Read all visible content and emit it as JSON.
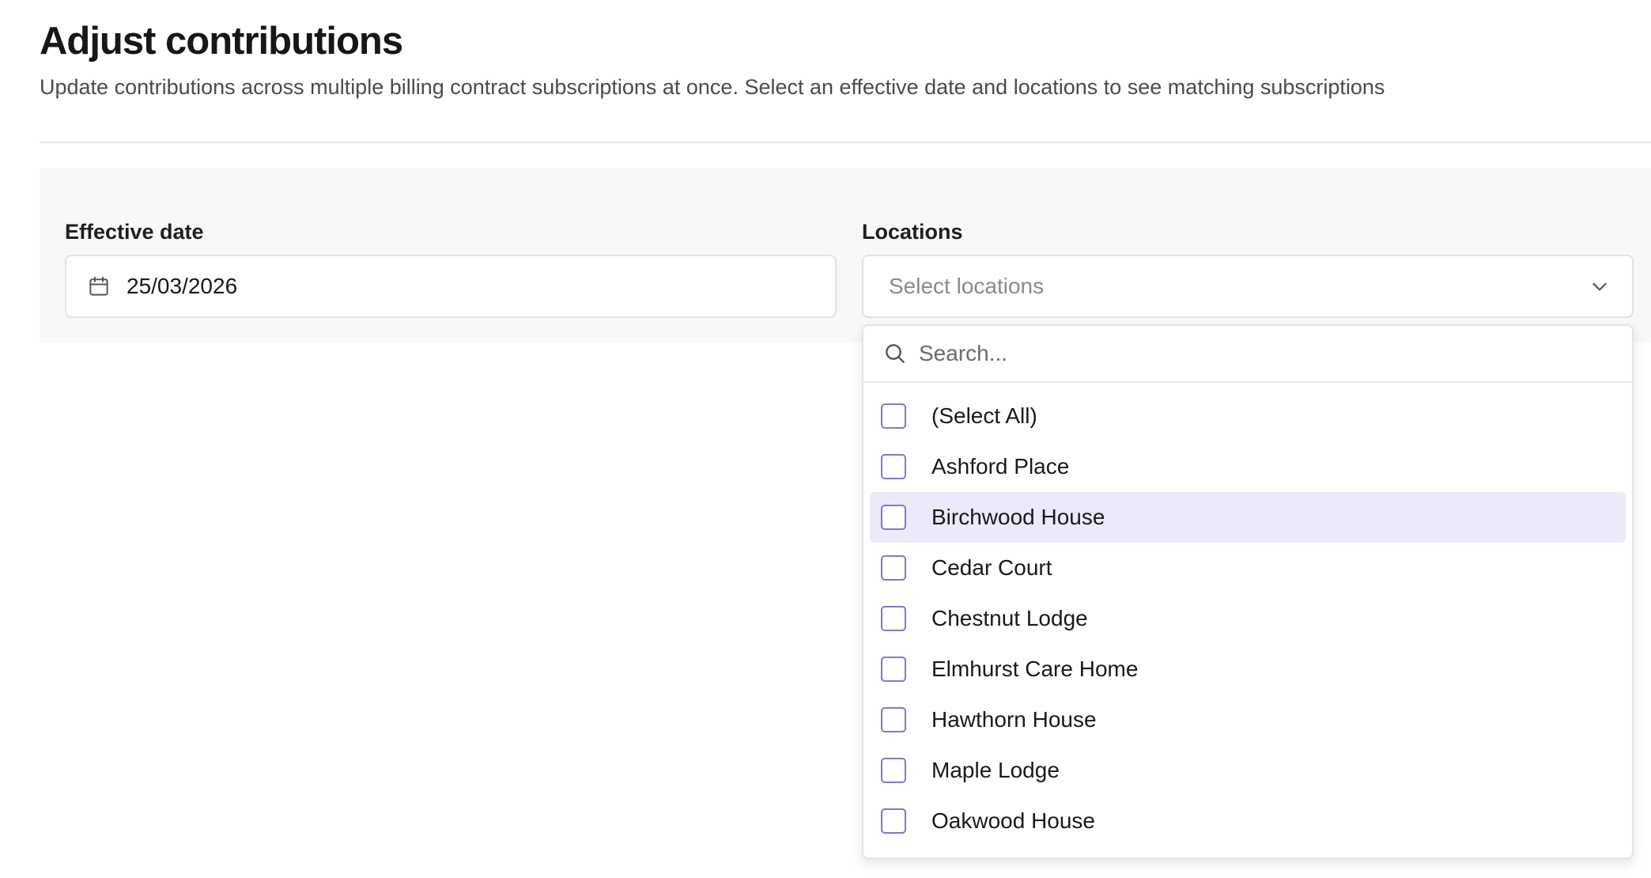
{
  "header": {
    "title": "Adjust contributions",
    "subtitle": "Update contributions across multiple billing contract subscriptions at once. Select an effective date and locations to see matching subscriptions"
  },
  "filters": {
    "effective_date": {
      "label": "Effective date",
      "value": "25/03/2026",
      "icon": "calendar-icon"
    },
    "locations": {
      "label": "Locations",
      "placeholder": "Select locations",
      "icon": "chevron-down-icon",
      "dropdown": {
        "search_placeholder": "Search...",
        "options": [
          {
            "label": "(Select All)",
            "checked": false,
            "highlighted": false
          },
          {
            "label": "Ashford Place",
            "checked": false,
            "highlighted": false
          },
          {
            "label": "Birchwood House",
            "checked": false,
            "highlighted": true
          },
          {
            "label": "Cedar Court",
            "checked": false,
            "highlighted": false
          },
          {
            "label": "Chestnut Lodge",
            "checked": false,
            "highlighted": false
          },
          {
            "label": "Elmhurst Care Home",
            "checked": false,
            "highlighted": false
          },
          {
            "label": "Hawthorn House",
            "checked": false,
            "highlighted": false
          },
          {
            "label": "Maple Lodge",
            "checked": false,
            "highlighted": false
          },
          {
            "label": "Oakwood House",
            "checked": false,
            "highlighted": false
          }
        ]
      }
    }
  },
  "colors": {
    "checkbox_border": "#7b79d1",
    "highlight_bg": "#ebeafa",
    "panel_bg": "#f8f8f8"
  }
}
